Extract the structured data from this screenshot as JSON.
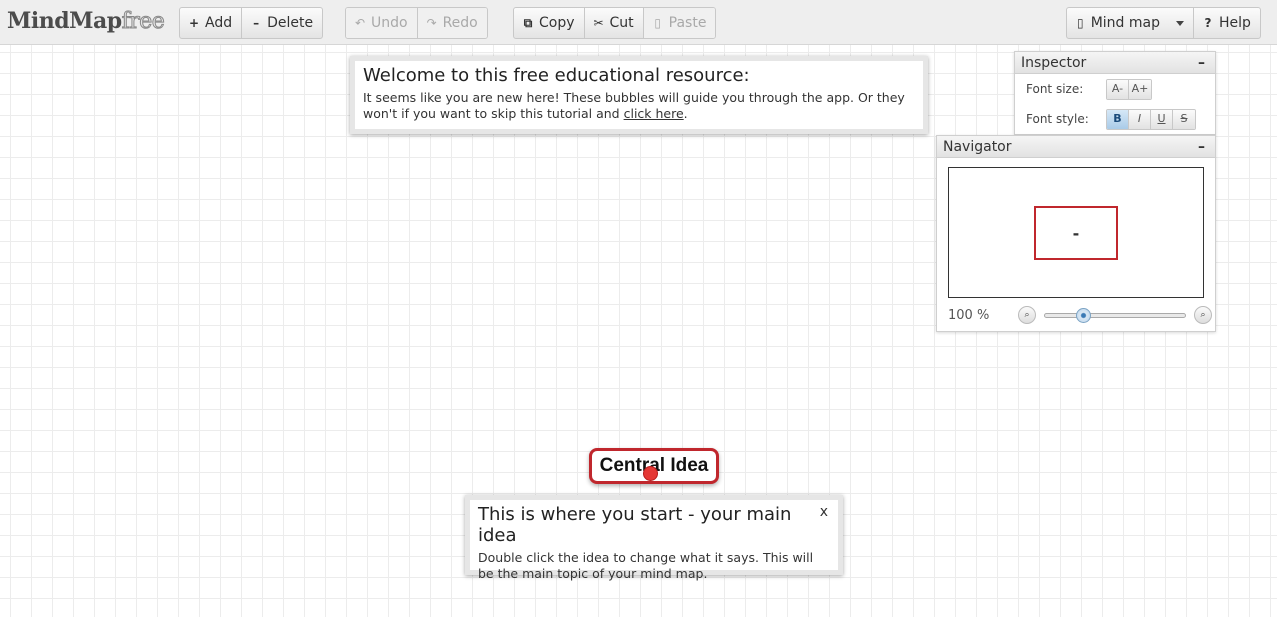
{
  "app": {
    "logo_main": "MindMap",
    "logo_accent": "free"
  },
  "toolbar": {
    "add": "Add",
    "delete": "Delete",
    "undo": "Undo",
    "redo": "Redo",
    "copy": "Copy",
    "cut": "Cut",
    "paste": "Paste",
    "mindmap": "Mind map",
    "help": "Help"
  },
  "welcome": {
    "title": "Welcome to this free educational resource:",
    "text_before": "It seems like you are new here! These bubbles will guide you through the app. Or they won't if you want to skip this tutorial and ",
    "link": "click here",
    "text_after": "."
  },
  "inspector": {
    "title": "Inspector",
    "minimize": "–",
    "font_size_label": "Font size:",
    "font_size_buttons": [
      "A-",
      "A+"
    ],
    "font_style_label": "Font style:",
    "font_style_buttons": [
      "B",
      "I",
      "U",
      "S"
    ]
  },
  "navigator": {
    "title": "Navigator",
    "minimize": "–",
    "preview_text": "-",
    "zoom_label": "100 %",
    "zoom_fraction": 0.25
  },
  "central_idea": {
    "label": "Central Idea"
  },
  "tip": {
    "title": "This is where you start - your main idea",
    "close": "x",
    "text": "Double click the idea to change what it says. This will be the main topic of your mind map."
  },
  "icons": {
    "add": "+",
    "delete": "–",
    "undo": "↶",
    "redo": "↷",
    "copy": "⧉",
    "cut": "✂",
    "paste": "▯",
    "mindmap": "▯",
    "help": "?",
    "zoom_out": "⌕",
    "zoom_in": "⌕"
  },
  "colors": {
    "accent_red": "#c0272d",
    "active_blue": "#a9cbe8"
  }
}
